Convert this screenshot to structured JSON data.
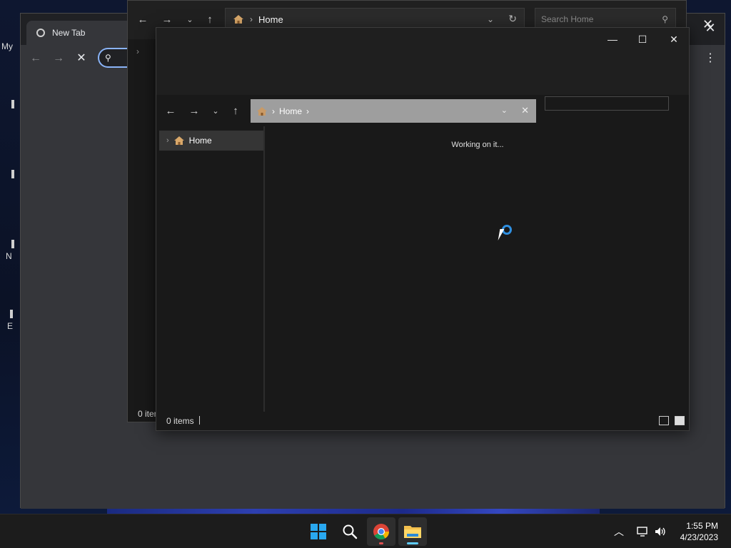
{
  "desktop": {
    "labels": [
      "My",
      "N",
      "E"
    ]
  },
  "chrome": {
    "tab_title": "New Tab",
    "close_glyph": "✕",
    "icons": [
      "back-icon",
      "forward-icon",
      "stop-loading-icon",
      "search-icon",
      "menu-icon"
    ]
  },
  "explorer_back": {
    "address": "Home",
    "search_placeholder": "Search Home",
    "status": "0 iten"
  },
  "explorer_front": {
    "address": "Home",
    "sidebar_items": [
      {
        "label": "Home"
      }
    ],
    "working_text": "Working on it...",
    "status_count": "0 items"
  },
  "taskbar": {
    "apps": [
      "start",
      "search",
      "chrome",
      "file-explorer"
    ],
    "time": "1:55 PM",
    "date": "4/23/2023"
  },
  "colors": {
    "accent": "#60cdff",
    "spinner": "#2f8fe0",
    "start_logo": "#29a8f0",
    "chrome_focus": "#8ab4f8"
  }
}
